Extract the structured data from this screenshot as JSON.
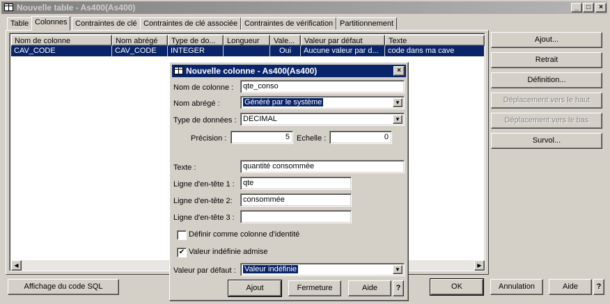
{
  "window": {
    "title": "Nouvelle table - As400(As400)",
    "min": "_",
    "max": "□",
    "close": "×"
  },
  "tabs": [
    "Table",
    "Colonnes",
    "Contraintes de clé",
    "Contraintes de clé associée",
    "Contraintes de vérification",
    "Partitionnement"
  ],
  "grid": {
    "headers": [
      "Nom de colonne",
      "Nom abrégé",
      "Type de do...",
      "Longueur",
      "Vale...",
      "Valeur par défaut",
      "Texte"
    ],
    "rows": [
      [
        "CAV_CODE",
        "CAV_CODE",
        "INTEGER",
        "",
        "Oui",
        "Aucune valeur par d...",
        "code dans ma cave"
      ]
    ]
  },
  "right_buttons": [
    "Ajout...",
    "Retrait",
    "Définition...",
    "Déplacement vers le haut",
    "Déplacement vers le bas",
    "Survol..."
  ],
  "bottom": {
    "sql": "Affichage du code SQL",
    "ok": "OK",
    "cancel": "Annulation",
    "help": "Aide",
    "q": "?"
  },
  "dialog": {
    "title": "Nouvelle colonne - As400(As400)",
    "close": "×",
    "name_label": "Nom de colonne :",
    "name_value": "qte_conso",
    "short_label": "Nom abrégé :",
    "short_value": "Généré par le système",
    "type_label": "Type de données :",
    "type_value": "DECIMAL",
    "precision_label": "Précision :",
    "precision_value": "5",
    "scale_label": "Echelle :",
    "scale_value": "0",
    "text_label": "Texte :",
    "text_value": "quantité consommée",
    "h1_label": "Ligne d'en-tête 1 :",
    "h1_value": "qte",
    "h2_label": "Ligne d'en-tête 2:",
    "h2_value": "consommée",
    "h3_label": "Ligne d'en-tête 3 :",
    "h3_value": "",
    "identity_label": "Définir comme colonne d'identité",
    "identity_checked": false,
    "null_label": "Valeur indéfinie admise",
    "null_checked": true,
    "default_label": "Valeur par défaut :",
    "default_value": "Valeur indéfinie",
    "add": "Ajout",
    "close_btn": "Fermeture",
    "help": "Aide",
    "q": "?"
  },
  "icons": {
    "arrow_down": "▼",
    "arrow_left": "◀",
    "arrow_right": "▶",
    "check": "✔"
  }
}
